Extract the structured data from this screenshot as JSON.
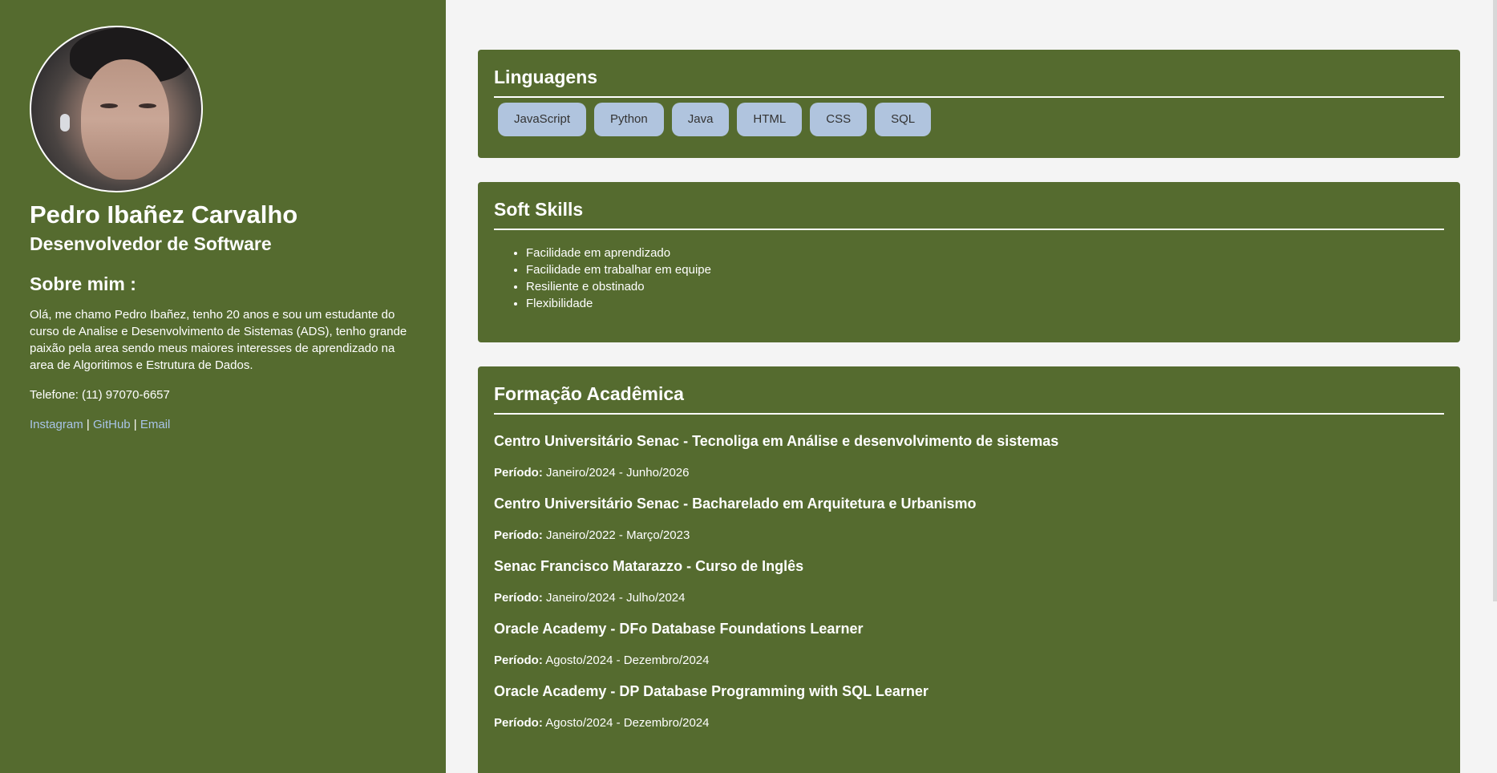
{
  "profile": {
    "name": "Pedro Ibañez Carvalho",
    "role": "Desenvolvedor de Software",
    "about_title": "Sobre mim :",
    "about_text": "Olá, me chamo Pedro Ibañez, tenho 20 anos e sou um estudante do curso de Analise e Desenvolvimento de Sistemas (ADS), tenho grande paixão pela area sendo meus maiores interesses de aprendizado na area de Algoritimos e Estrutura de Dados.",
    "phone": "Telefone: (11) 97070-6657",
    "links": {
      "instagram": "Instagram",
      "github": "GitHub",
      "email": "Email",
      "separator": " | "
    }
  },
  "languages": {
    "title": "Linguagens",
    "items": [
      "JavaScript",
      "Python",
      "Java",
      "HTML",
      "CSS",
      "SQL"
    ]
  },
  "soft_skills": {
    "title": "Soft Skills",
    "items": [
      "Facilidade em aprendizado",
      "Facilidade em trabalhar em equipe",
      "Resiliente e obstinado",
      "Flexibilidade"
    ]
  },
  "education": {
    "title": "Formação Acadêmica",
    "period_label": "Período:",
    "items": [
      {
        "title": "Centro Universitário Senac - Tecnoliga em Análise e desenvolvimento de sistemas",
        "period": "Janeiro/2024 - Junho/2026"
      },
      {
        "title": "Centro Universitário Senac - Bacharelado em Arquitetura e Urbanismo",
        "period": "Janeiro/2022 - Março/2023"
      },
      {
        "title": "Senac Francisco Matarazzo - Curso de Inglês",
        "period": "Janeiro/2024 - Julho/2024"
      },
      {
        "title": "Oracle Academy - DFo Database Foundations Learner",
        "period": "Agosto/2024 - Dezembro/2024"
      },
      {
        "title": "Oracle Academy - DP Database Programming with SQL Learner",
        "period": "Agosto/2024 - Dezembro/2024"
      }
    ]
  },
  "colors": {
    "panel": "#556b2f",
    "background": "#f4f4f4",
    "chip": "#b0c4de",
    "link": "#a9c4e8"
  }
}
